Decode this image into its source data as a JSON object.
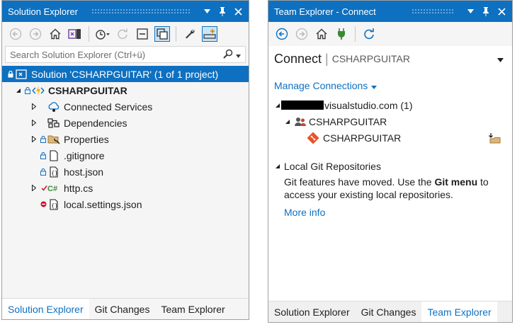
{
  "solution_explorer": {
    "title": "Solution Explorer",
    "search_placeholder": "Search Solution Explorer (Ctrl+ü)",
    "tree": {
      "solution": "Solution 'CSHARPGUITAR' (1 of 1 project)",
      "project": "CSHARPGUITAR",
      "items": [
        {
          "label": "Connected Services"
        },
        {
          "label": "Dependencies"
        },
        {
          "label": "Properties"
        },
        {
          "label": ".gitignore"
        },
        {
          "label": "host.json"
        },
        {
          "label": "http.cs"
        },
        {
          "label": "local.settings.json"
        }
      ]
    },
    "tabs": [
      "Solution Explorer",
      "Git Changes",
      "Team Explorer"
    ],
    "active_tab": "Solution Explorer"
  },
  "team_explorer": {
    "title": "Team Explorer - Connect",
    "section": "Connect",
    "project": "CSHARPGUITAR",
    "manage_connections": "Manage Connections",
    "server_suffix": "visualstudio.com (1)",
    "collection": "CSHARPGUITAR",
    "repository": "CSHARPGUITAR",
    "local_git_header": "Local Git Repositories",
    "git_msg_before": "Git features have moved. Use the ",
    "git_msg_bold": "Git menu",
    "git_msg_after": " to access your existing local repositories.",
    "more_info": "More info",
    "tabs": [
      "Solution Explorer",
      "Git Changes",
      "Team Explorer"
    ],
    "active_tab": "Team Explorer"
  },
  "colors": {
    "accent": "#0e70c0",
    "selected_bg": "#cce4f7"
  }
}
